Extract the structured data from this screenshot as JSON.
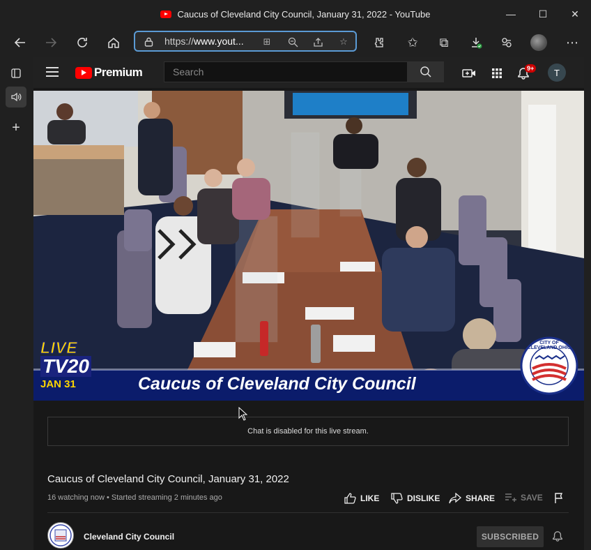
{
  "window": {
    "title": "Caucus of Cleveland City Council, January 31, 2022 - YouTube",
    "minimize_glyph": "—",
    "maximize_glyph": "☐",
    "close_glyph": "✕"
  },
  "browser": {
    "url_prefix": "https://",
    "url_host": "www.yout...",
    "icons": [
      "back-icon",
      "forward-icon",
      "refresh-icon",
      "home-icon",
      "lock-icon",
      "split-screen-icon",
      "zoom-out-icon",
      "share-icon",
      "add-favorite-icon",
      "extensions-icon",
      "favorites-icon",
      "collections-icon",
      "downloads-icon",
      "games-icon",
      "profile-avatar",
      "more-icon"
    ]
  },
  "sidebar": {
    "items": [
      "tab-actions-icon",
      "speaker-icon",
      "add-icon"
    ]
  },
  "youtube": {
    "logo_text": "Premium",
    "search_placeholder": "Search",
    "notification_count": "9+",
    "avatar_letter": "T"
  },
  "video": {
    "banner_text": "Caucus of Cleveland City Council",
    "logo_live": "LIVE",
    "logo_tv": "TV20",
    "logo_date": "JAN 31",
    "seal_text": "CITY OF CLEVELAND OHIO",
    "colors": {
      "banner": "#0b1c6b",
      "live_yellow": "#ffd600",
      "tv_red": "#c62828"
    }
  },
  "chat": {
    "message": "Chat is disabled for this live stream."
  },
  "details": {
    "title": "Caucus of Cleveland City Council, January 31, 2022",
    "meta": "16 watching now • Started streaming 2 minutes ago",
    "like_label": "LIKE",
    "dislike_label": "DISLIKE",
    "share_label": "SHARE",
    "save_label": "SAVE"
  },
  "channel": {
    "name": "Cleveland City Council",
    "subscribe_label": "SUBSCRIBED"
  }
}
